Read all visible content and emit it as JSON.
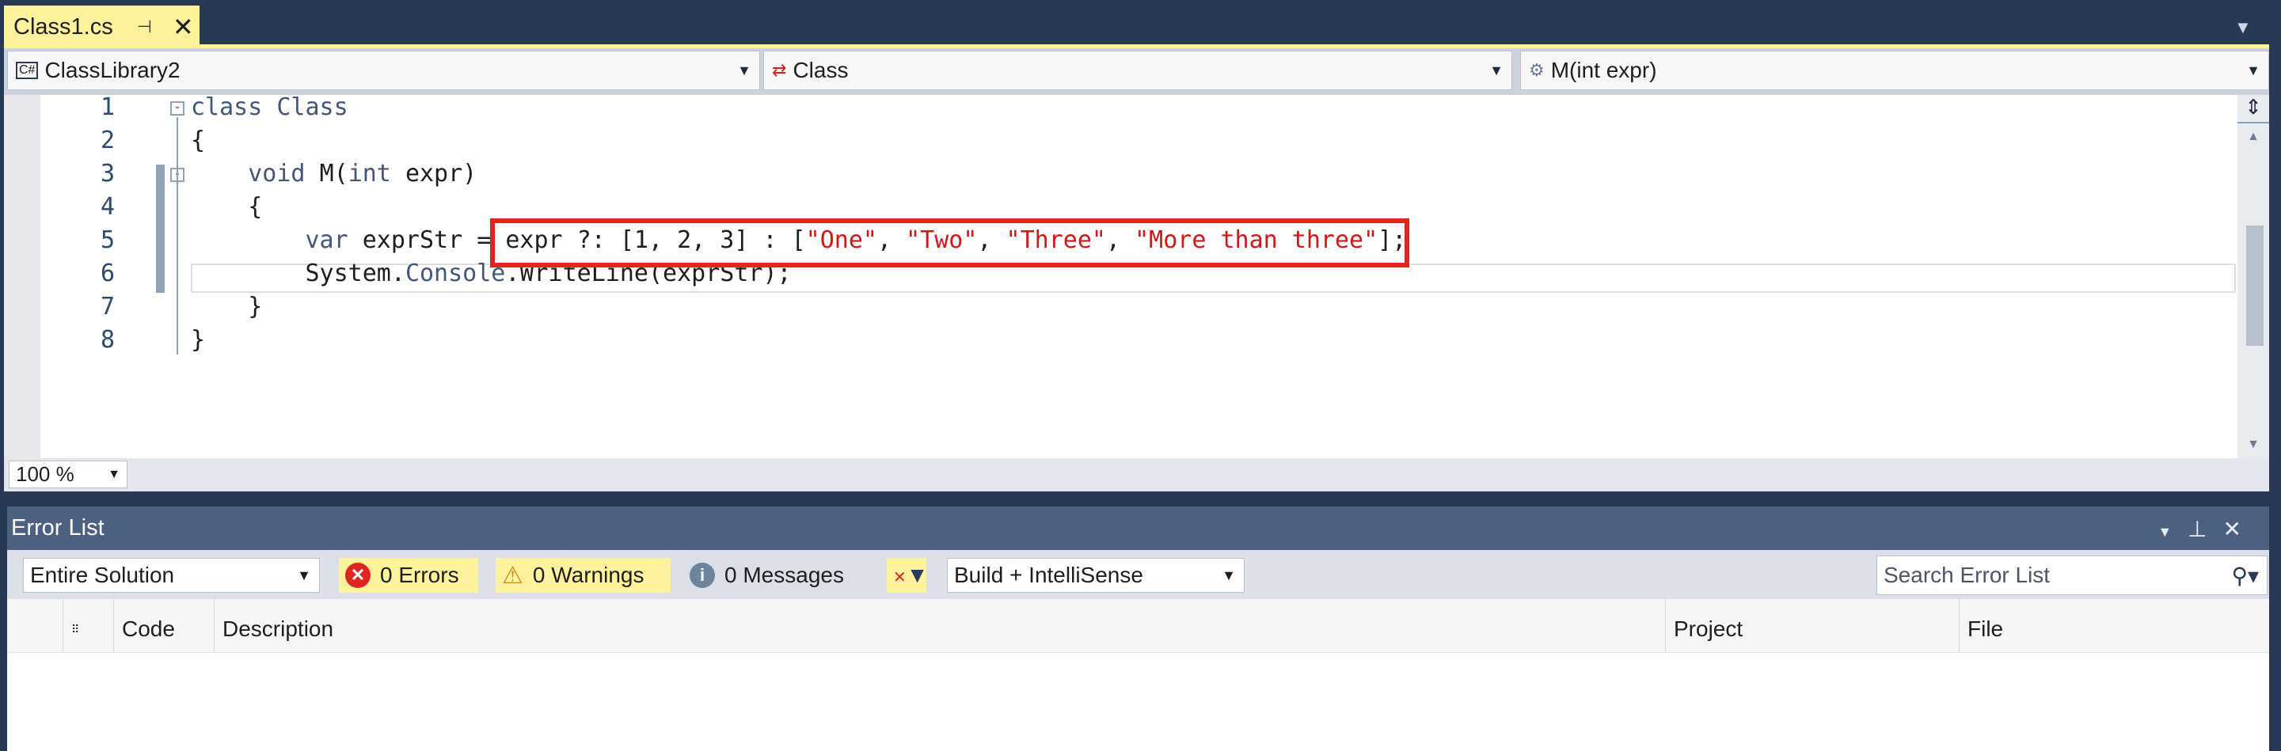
{
  "tab": {
    "title": "Class1.cs",
    "pin_icon": "pin-icon",
    "close_icon": "close-icon"
  },
  "nav": {
    "project": "ClassLibrary2",
    "type": "Class",
    "member": "M(int expr)"
  },
  "editor": {
    "line_numbers": [
      "1",
      "2",
      "3",
      "4",
      "5",
      "6",
      "7",
      "8"
    ],
    "lines": [
      [
        {
          "t": "class ",
          "c": "kw"
        },
        {
          "t": "Class",
          "c": "ty"
        }
      ],
      [
        {
          "t": "{",
          "c": ""
        }
      ],
      [
        {
          "t": "    "
        },
        {
          "t": "void ",
          "c": "kw"
        },
        {
          "t": "M(",
          "c": ""
        },
        {
          "t": "int ",
          "c": "kw"
        },
        {
          "t": "expr)",
          "c": ""
        }
      ],
      [
        {
          "t": "    {",
          "c": ""
        }
      ],
      [
        {
          "t": "        "
        },
        {
          "t": "var ",
          "c": "kw"
        },
        {
          "t": "exprStr = expr ?: [1, 2, 3] : [",
          "c": ""
        },
        {
          "t": "\"One\"",
          "c": "str"
        },
        {
          "t": ", ",
          "c": ""
        },
        {
          "t": "\"Two\"",
          "c": "str"
        },
        {
          "t": ", ",
          "c": ""
        },
        {
          "t": "\"Three\"",
          "c": "str"
        },
        {
          "t": ", ",
          "c": ""
        },
        {
          "t": "\"More than three\"",
          "c": "str"
        },
        {
          "t": "];",
          "c": ""
        }
      ],
      [
        {
          "t": "        System.",
          "c": ""
        },
        {
          "t": "Console",
          "c": "ty"
        },
        {
          "t": ".WriteLine(exprStr);",
          "c": ""
        }
      ],
      [
        {
          "t": "    }",
          "c": ""
        }
      ],
      [
        {
          "t": "}",
          "c": ""
        }
      ]
    ],
    "highlight_color": "#e0251f",
    "zoom": "100 %"
  },
  "error_list": {
    "title": "Error List",
    "scope": "Entire Solution",
    "errors": "0 Errors",
    "warnings": "0 Warnings",
    "messages": "0 Messages",
    "source": "Build + IntelliSense",
    "search_placeholder": "Search Error List",
    "columns": [
      "Code",
      "Description",
      "Project",
      "File"
    ]
  }
}
